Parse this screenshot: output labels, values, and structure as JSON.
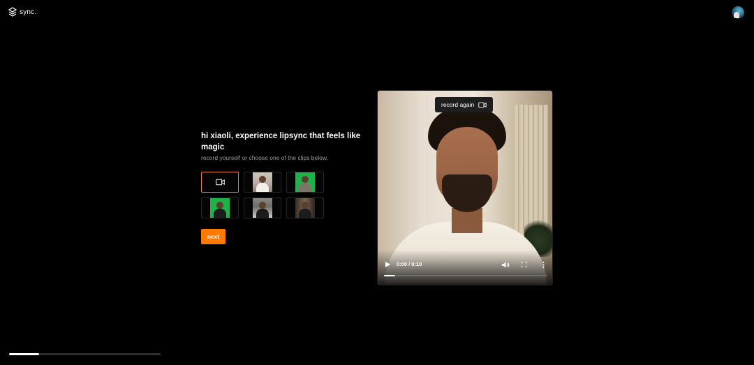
{
  "app": {
    "logo_text": "sync."
  },
  "intro": {
    "headline": "hi xiaoli, experience lipsync that feels like magic",
    "subline": "record yourself or choose one of the clips below."
  },
  "clips": {
    "record_icon": "video-camera-icon",
    "thumbnails": [
      "clip-1",
      "clip-2",
      "clip-3",
      "clip-4",
      "clip-5"
    ]
  },
  "actions": {
    "next_label": "next"
  },
  "video": {
    "record_again_label": "record again",
    "record_again_icon": "video-camera-icon",
    "time": "0:00 / 0:10",
    "progress": 0.07
  },
  "page_progress": 0.2,
  "colors": {
    "accent": "#ff7a00",
    "background": "#000000"
  }
}
